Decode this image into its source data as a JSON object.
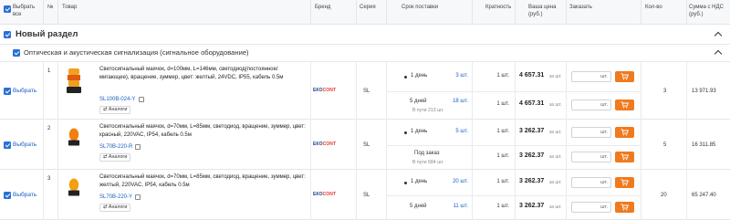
{
  "columns": {
    "select_all": "Выбрать\nвсе",
    "num": "№",
    "product": "Товар",
    "brand": "Бренд",
    "series": "Серия",
    "delivery": "Срок поставки",
    "multiplicity": "Кратность",
    "price": "Ваша цена\n(руб.)",
    "order": "Заказать",
    "qty": "Кол-во",
    "sum": "Сумма с НДС\n(руб.)"
  },
  "section": {
    "title": "Новый раздел"
  },
  "subsection": {
    "title": "Оптическая и акустическая сигнализация (сигнальное оборудование)"
  },
  "select_label": "Выбрать",
  "analogs_label": "Аналоги",
  "unit_short": "шт.",
  "per_unit": "за шт.",
  "products": [
    {
      "num": "1",
      "desc": "Светосигнальный маячок, d=100мм, L=146мм, светодиод(постоянное/мигающее), вращение, зуммер, цвет: желтый, 24VDC, IP55, кабель 0.5м",
      "code": "SL100B-024-Y",
      "brand": "ЕКОCONT",
      "series": "SL",
      "offers": [
        {
          "term": "1 день",
          "dot": true,
          "stock": "3 шт.",
          "stock_note": "",
          "mult": "1 шт.",
          "price": "4 657.31"
        },
        {
          "term": "5 дней",
          "dot": false,
          "stock": "18 шт.",
          "stock_note": "В пути 213 шт.",
          "mult": "1 шт.",
          "price": "4 657.31"
        }
      ],
      "qty": "3",
      "sum": "13 971.93"
    },
    {
      "num": "2",
      "desc": "Светосигнальный маячок, d=70мм, L=85мм, светодиод, вращение, зуммер, цвет: красный, 220VAC, IP54, кабель 0.5м",
      "code": "SL70B-220-R",
      "brand": "ЕКОCONT",
      "series": "SL",
      "offers": [
        {
          "term": "1 день",
          "dot": true,
          "stock": "5 шт.",
          "stock_note": "",
          "mult": "1 шт.",
          "price": "3 262.37"
        },
        {
          "term": "Под заказ",
          "dot": false,
          "stock": "",
          "stock_note": "В пути 684 шт.",
          "mult": "1 шт.",
          "price": "3 262.37"
        }
      ],
      "qty": "5",
      "sum": "16 311.85"
    },
    {
      "num": "3",
      "desc": "Светосигнальный маячок, d=70мм, L=85мм, светодиод, вращение, зуммер, цвет: желтый, 220VAC, IP54, кабель 0.5м",
      "code": "SL70B-220-Y",
      "brand": "ЕКОCONT",
      "series": "SL",
      "offers": [
        {
          "term": "1 день",
          "dot": true,
          "stock": "20 шт.",
          "stock_note": "",
          "mult": "1 шт.",
          "price": "3 262.37"
        },
        {
          "term": "5 дней",
          "dot": false,
          "stock": "11 шт.",
          "stock_note": "",
          "mult": "1 шт.",
          "price": "3 262.37"
        }
      ],
      "qty": "20",
      "sum": "65 247.40"
    }
  ],
  "colors": {
    "accent": "#2a6fd6",
    "cart": "#f07a1e",
    "link": "#1b5fc4"
  }
}
